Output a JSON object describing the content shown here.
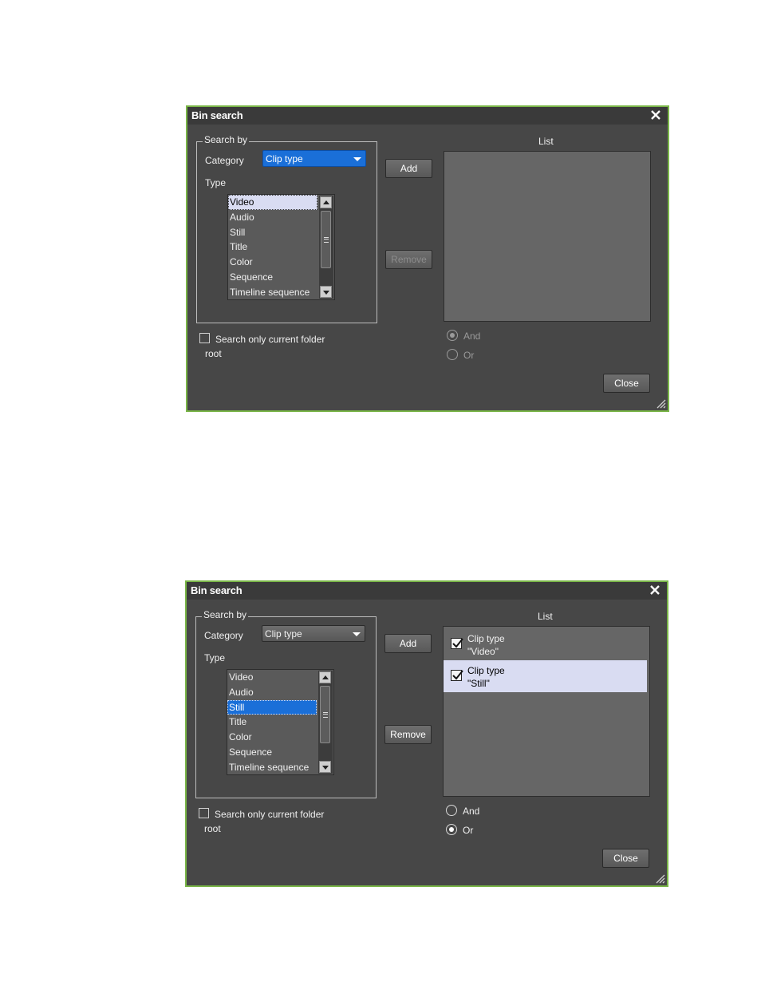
{
  "dialog1": {
    "title": "Bin search",
    "search_by_label": "Search by",
    "category_label": "Category",
    "category_value": "Clip type",
    "type_label": "Type",
    "type_items": [
      "Video",
      "Audio",
      "Still",
      "Title",
      "Color",
      "Sequence",
      "Timeline sequence"
    ],
    "selected_type": "Video",
    "add_label": "Add",
    "remove_label": "Remove",
    "remove_enabled": false,
    "list_label": "List",
    "list_items": [],
    "search_folder_label": "Search only current folder",
    "search_folder_checked": false,
    "folder_value": "root",
    "and_label": "And",
    "or_label": "Or",
    "logic_selected": "And",
    "logic_enabled": false,
    "close_label": "Close"
  },
  "dialog2": {
    "title": "Bin search",
    "search_by_label": "Search by",
    "category_label": "Category",
    "category_value": "Clip type",
    "type_label": "Type",
    "type_items": [
      "Video",
      "Audio",
      "Still",
      "Title",
      "Color",
      "Sequence",
      "Timeline sequence"
    ],
    "selected_type": "Still",
    "add_label": "Add",
    "remove_label": "Remove",
    "remove_enabled": true,
    "list_label": "List",
    "list_items": [
      {
        "line1": "Clip type",
        "line2": "\"Video\"",
        "checked": true,
        "selected": false
      },
      {
        "line1": "Clip type",
        "line2": "\"Still\"",
        "checked": true,
        "selected": true
      }
    ],
    "search_folder_label": "Search only current folder",
    "search_folder_checked": false,
    "folder_value": "root",
    "and_label": "And",
    "or_label": "Or",
    "logic_selected": "Or",
    "logic_enabled": true,
    "close_label": "Close"
  },
  "colors": {
    "dialog_bg": "#474747",
    "border": "#7ab648",
    "selection_blue": "#1a6fd8",
    "selection_light": "#d9dcf2"
  }
}
